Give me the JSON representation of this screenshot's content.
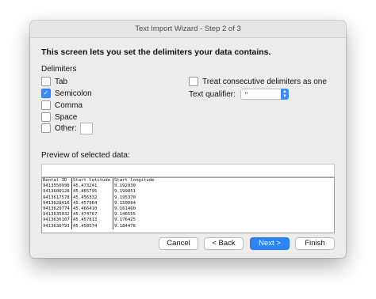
{
  "window": {
    "title": "Text Import Wizard - Step 2 of 3"
  },
  "intro": "This screen lets you set the delimiters your data contains.",
  "delimiters": {
    "label": "Delimiters",
    "tab": {
      "label": "Tab",
      "checked": false
    },
    "semicolon": {
      "label": "Semicolon",
      "checked": true
    },
    "comma": {
      "label": "Comma",
      "checked": false
    },
    "space": {
      "label": "Space",
      "checked": false
    },
    "other": {
      "label": "Other:",
      "checked": false,
      "value": ""
    }
  },
  "consecutive": {
    "label": "Treat consecutive delimiters as one",
    "checked": false
  },
  "qualifier": {
    "label": "Text qualifier:",
    "value": "\""
  },
  "preview": {
    "label": "Preview of selected data:",
    "headers": [
      "Rental ID",
      "Start latitude",
      "Start longitude"
    ],
    "rows": [
      [
        "9413550998",
        "45.473241",
        "9.192930"
      ],
      [
        "9413600128",
        "45.465795",
        "9.199851"
      ],
      [
        "9413617578",
        "45.456332",
        "9.195370"
      ],
      [
        "9413628416",
        "45.457964",
        "9.150084"
      ],
      [
        "9413629774",
        "45.466410",
        "9.161460"
      ],
      [
        "9413635032",
        "45.474767",
        "9.146555"
      ],
      [
        "9413636107",
        "45.457813",
        "9.176425"
      ],
      [
        "9413636793",
        "45.458574",
        "9.184476"
      ]
    ]
  },
  "buttons": {
    "cancel": "Cancel",
    "back": "< Back",
    "next": "Next >",
    "finish": "Finish"
  },
  "colors": {
    "accent": "#3a8cf6",
    "window_bg": "#ececec"
  }
}
